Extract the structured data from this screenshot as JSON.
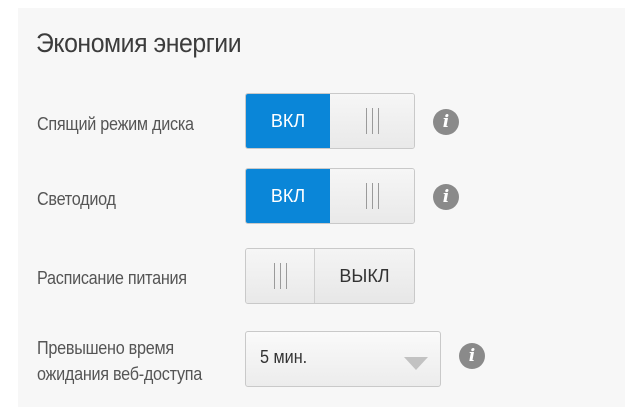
{
  "section": {
    "title": "Экономия энергии"
  },
  "settings": {
    "disk_sleep": {
      "label": "Спящий режим диска",
      "state": "ВКЛ",
      "enabled": true
    },
    "led": {
      "label": "Светодиод",
      "state": "ВКЛ",
      "enabled": true
    },
    "power_schedule": {
      "label": "Расписание питания",
      "state": "ВЫКЛ",
      "enabled": false
    },
    "web_timeout": {
      "label_line1": "Превышено время",
      "label_line2": "ожидания веб-доступа",
      "value": "5 мин."
    }
  },
  "icons": {
    "info": "i"
  },
  "colors": {
    "accent": "#0a86d8",
    "background": "#f7f7f7"
  }
}
